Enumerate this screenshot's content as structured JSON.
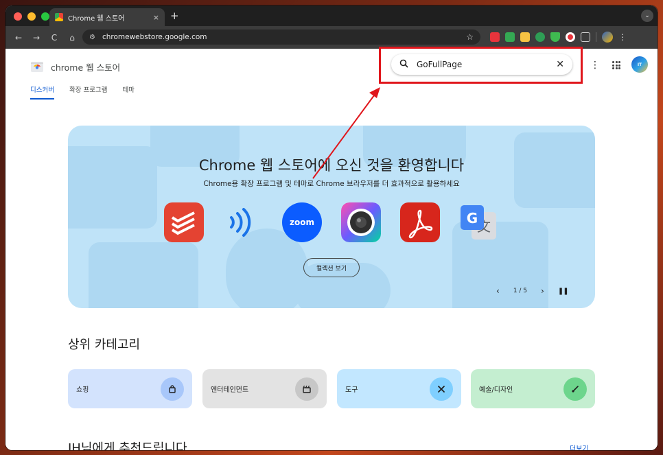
{
  "browser": {
    "tab_title": "Chrome 웹 스토어",
    "tab_close": "×",
    "new_tab": "+",
    "menu_glyph": "⌄",
    "nav": {
      "back": "←",
      "forward": "→",
      "reload": "C",
      "home": "⌂"
    },
    "url": "chromewebstore.google.com",
    "star": "☆",
    "kebab": "⋮",
    "traffic_colors": [
      "#ff5f57",
      "#febc2e",
      "#28c840"
    ]
  },
  "header": {
    "brand": "chrome 웹 스토어",
    "search_value": "GoFullPage",
    "search_icon": "⚲",
    "clear_icon": "✕",
    "kebab": "⋮",
    "avatar_text": "IT"
  },
  "nav_tabs": [
    {
      "label": "디스커버",
      "active": true
    },
    {
      "label": "확장 프로그램",
      "active": false
    },
    {
      "label": "테마",
      "active": false
    }
  ],
  "hero": {
    "title": "Chrome 웹 스토어에 오신 것을 환영합니다",
    "subtitle": "Chrome용 확장 프로그램 및 테마로 Chrome 브라우저를 더 효과적으로 활용하세요",
    "cta": "컬렉션 보기",
    "page": "1 / 5",
    "prev": "‹",
    "next": "›",
    "pause": "❚❚",
    "apps": [
      {
        "name": "todoist-icon",
        "text": "",
        "color": "#e44332"
      },
      {
        "name": "nfc-waves-icon",
        "text": ")))",
        "color": "#bfe3f8"
      },
      {
        "name": "zoom-icon",
        "text": "zoom",
        "color": "#0b5cff"
      },
      {
        "name": "camera-lens-icon",
        "text": "",
        "color": "#2f2f2f"
      },
      {
        "name": "acrobat-icon",
        "text": "",
        "color": "#d7261c"
      },
      {
        "name": "google-translate-icon",
        "text": "G",
        "color": "#4285f4"
      }
    ]
  },
  "categories": {
    "title": "상위 카테고리",
    "items": [
      {
        "label": "쇼핑",
        "bg": "#d3e3fd",
        "icon_bg": "#a8c7fa",
        "glyph": "🛍"
      },
      {
        "label": "엔터테인먼트",
        "bg": "#e3e3e3",
        "icon_bg": "#c7c7c7",
        "glyph": "🎬"
      },
      {
        "label": "도구",
        "bg": "#c2e7ff",
        "icon_bg": "#7fcfff",
        "glyph": "✂"
      },
      {
        "label": "예술/디자인",
        "bg": "#c4eed0",
        "icon_bg": "#6dd58c",
        "glyph": "✎"
      }
    ]
  },
  "recommend": {
    "title": "JH님에게 추천드립니다",
    "more": "더보기"
  },
  "colors": {
    "accent": "#0b57d0",
    "highlight": "#e0161c"
  }
}
